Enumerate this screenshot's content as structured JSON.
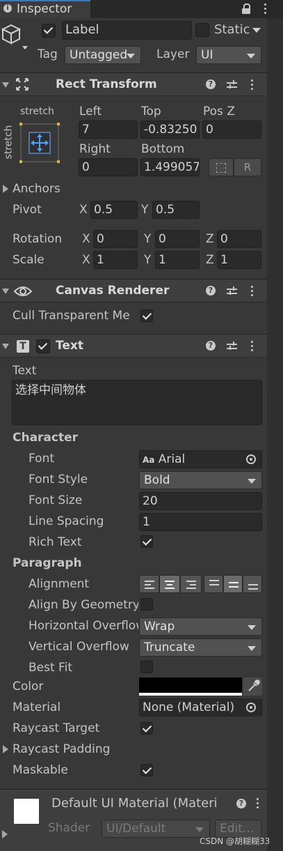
{
  "tab": {
    "title": "Inspector"
  },
  "header": {
    "active": true,
    "name": "Label",
    "static_label": "Static",
    "tag_label": "Tag",
    "tag_value": "Untagged",
    "layer_label": "Layer",
    "layer_value": "UI"
  },
  "rect_transform": {
    "title": "Rect Transform",
    "anchor_preset_h": "stretch",
    "anchor_preset_v": "stretch",
    "left_label": "Left",
    "top_label": "Top",
    "posz_label": "Pos Z",
    "left": "7",
    "top": "-0.83250",
    "posz": "0",
    "right_label": "Right",
    "bottom_label": "Bottom",
    "right": "0",
    "bottom": "1.499057",
    "raw_btn": "R",
    "anchors_label": "Anchors",
    "pivot_label": "Pivot",
    "pivot_x": "0.5",
    "pivot_y": "0.5",
    "rotation_label": "Rotation",
    "rot_x": "0",
    "rot_y": "0",
    "rot_z": "0",
    "scale_label": "Scale",
    "scale_x": "1",
    "scale_y": "1",
    "scale_z": "1",
    "axis_x": "X",
    "axis_y": "Y",
    "axis_z": "Z"
  },
  "canvas_renderer": {
    "title": "Canvas Renderer",
    "cull_label": "Cull Transparent Me",
    "cull_checked": true
  },
  "text_component": {
    "title": "Text",
    "enabled": true,
    "text_label": "Text",
    "text_value": "选择中间物体",
    "character_label": "Character",
    "font_label": "Font",
    "font_value": "Arial",
    "font_icon": "Aa",
    "font_style_label": "Font Style",
    "font_style_value": "Bold",
    "font_size_label": "Font Size",
    "font_size_value": "20",
    "line_spacing_label": "Line Spacing",
    "line_spacing_value": "1",
    "rich_text_label": "Rich Text",
    "rich_text_checked": true,
    "paragraph_label": "Paragraph",
    "alignment_label": "Alignment",
    "align_by_geometry_label": "Align By Geometry",
    "align_by_geometry_checked": false,
    "h_overflow_label": "Horizontal Overflow",
    "h_overflow_value": "Wrap",
    "v_overflow_label": "Vertical Overflow",
    "v_overflow_value": "Truncate",
    "best_fit_label": "Best Fit",
    "best_fit_checked": false,
    "color_label": "Color",
    "color_value": "#000000",
    "material_label": "Material",
    "material_value": "None (Material)",
    "raycast_target_label": "Raycast Target",
    "raycast_target_checked": true,
    "raycast_padding_label": "Raycast Padding",
    "maskable_label": "Maskable",
    "maskable_checked": true
  },
  "material_preview": {
    "name": "Default UI Material (Materi",
    "shader_label": "Shader",
    "shader_value": "UI/Default",
    "edit_label": "Edit..."
  },
  "watermark": "CSDN @胡糊糊33"
}
